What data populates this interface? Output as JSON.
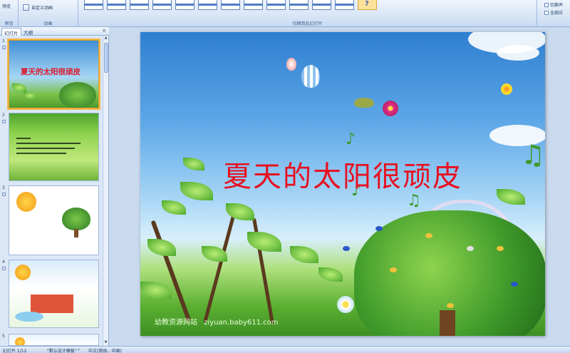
{
  "ribbon": {
    "preview_label": "预览",
    "preview_group": "预览",
    "custom_animation": "自定义动画",
    "animation_group": "动画",
    "transition_group": "切换到此幻灯片",
    "right_item_1": "切换声",
    "right_item_2": "全部应"
  },
  "pane": {
    "tab_slides": "幻灯片",
    "tab_outline": "大纲",
    "close": "×",
    "slide_numbers": [
      "1",
      "2",
      "3",
      "4",
      "5"
    ],
    "thumb1_title": "夏天的太阳很顽皮"
  },
  "slide": {
    "title": "夏天的太阳很顽皮",
    "watermark_site": "幼教资源网站",
    "watermark_url": "ziyuan.baby611.com"
  },
  "status": {
    "slide_info": "幻灯片 1/12",
    "theme": "\"默认设计模板\"",
    "language": "中文(简体，中国)"
  }
}
